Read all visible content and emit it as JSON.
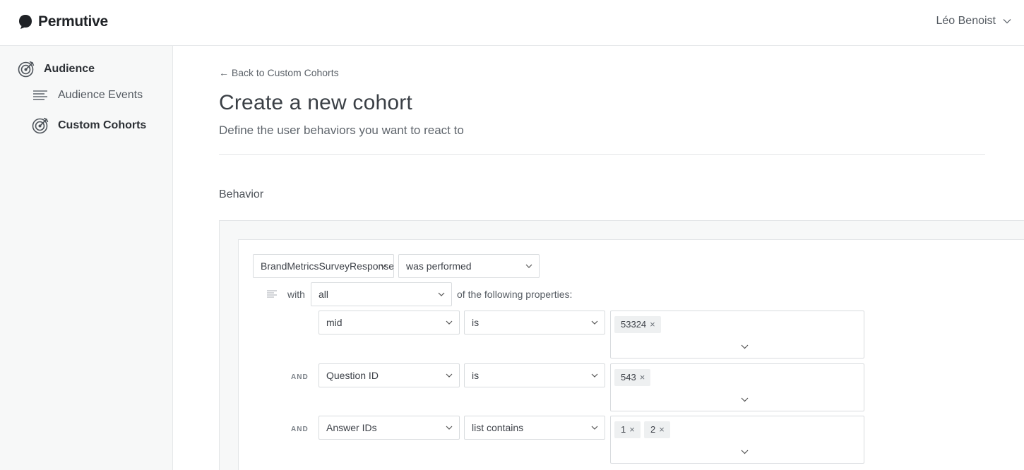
{
  "brand": {
    "name": "Permutive"
  },
  "user": {
    "name": "Léo Benoist"
  },
  "sidebar": {
    "items": [
      {
        "label": "Audience"
      },
      {
        "label": "Audience Events"
      },
      {
        "label": "Custom Cohorts"
      }
    ]
  },
  "page": {
    "back_link": "← Back to Custom Cohorts",
    "title": "Create a new cohort",
    "subtitle": "Define the user behaviors you want to react to",
    "section": "Behavior"
  },
  "behavior": {
    "event": "BrandMetricsSurveyResponse",
    "performed": "was performed",
    "with_label": "with",
    "quantifier": "all",
    "properties_label": "of the following properties:",
    "conditions": [
      {
        "connector": "",
        "property": "mid",
        "operator": "is",
        "values": [
          "53324"
        ]
      },
      {
        "connector": "AND",
        "property": "Question ID",
        "operator": "is",
        "values": [
          "543"
        ]
      },
      {
        "connector": "AND",
        "property": "Answer IDs",
        "operator": "list contains",
        "values": [
          "1",
          "2"
        ]
      }
    ],
    "remove_glyph": "×"
  },
  "icons": {
    "logo": "permutive-logo-icon",
    "user_chevron": "chevron-down-icon",
    "audience": "target-icon",
    "events": "list-icon",
    "filter": "filter-lines-icon"
  }
}
